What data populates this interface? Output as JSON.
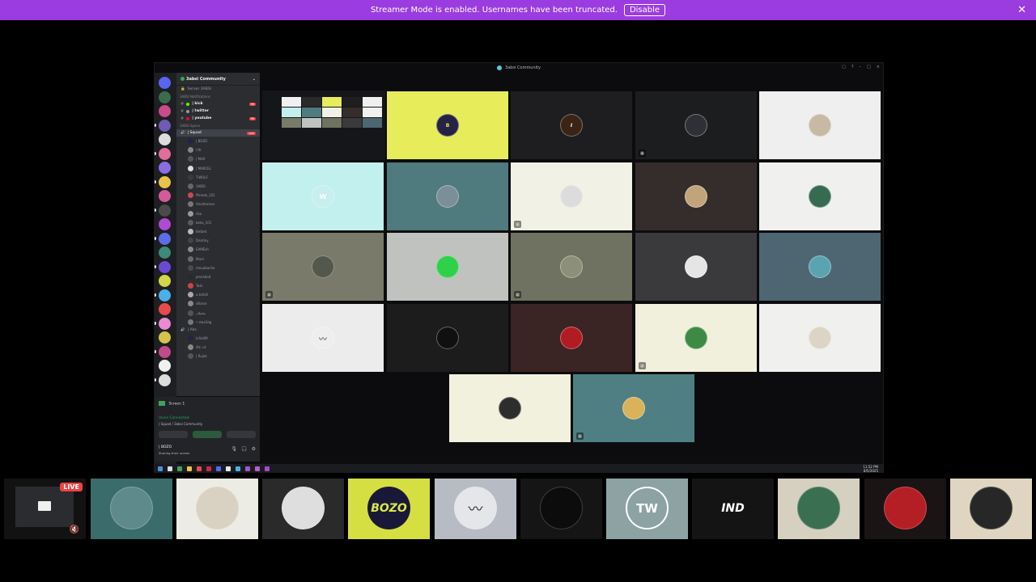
{
  "banner": {
    "message": "Streamer Mode is enabled. Usernames have been truncated.",
    "disable_label": "Disable",
    "close_icon": "close-icon"
  },
  "shared_window": {
    "title": "3absi Community",
    "controls": [
      "▢",
      "?",
      "–",
      "□",
      "×"
    ]
  },
  "discord": {
    "server_name": "3absi Community",
    "server_header": "Server 3ABSI",
    "categories": [
      "3ABSI Notifications",
      "3ABSI Space"
    ],
    "text_channels": [
      {
        "name": "| kick",
        "bullet": "#53fc18",
        "badge": "99"
      },
      {
        "name": "| twitter",
        "bullet": "#949ba4",
        "badge": ""
      },
      {
        "name": "| youtube",
        "bullet": "#ff0033",
        "badge": "99"
      }
    ],
    "voice_channel": "| Squad",
    "voice_live": "LIVE",
    "members": [
      "| BOZO",
      "l.ftr",
      "| Mo9",
      "| MARCEL",
      "T.WOLF",
      "3ABSI",
      "ffmodo_101",
      "Alnothemar",
      "Azo",
      "beko_101",
      "Betbet",
      "Dentiny",
      "EAMEsh",
      "Marri",
      "mouabache",
      "pressbod",
      "Tesk",
      "a.tofalli",
      "silbsse",
      "سلطان",
      "• ewa3ag"
    ],
    "second_voice": "| Abs",
    "second_members": [
      "Lrllo0M",
      "4lz..ut",
      "| Rujok"
    ],
    "panel": {
      "stream_title": "Screen 1",
      "voice_status": "Voice Connected",
      "voice_location": "| Squad / 3absi Community",
      "user": "| BOZO",
      "user_status": "Sharing their screen"
    },
    "clock": {
      "time": "11:52 PM",
      "date": "8/5/2025"
    }
  },
  "grid": {
    "tiles": [
      {
        "bg": "#e6ec5a",
        "avatar": "#262246",
        "kind": "bozo",
        "flag": false
      },
      {
        "bg": "#1e1e20",
        "avatar": "#3a2416",
        "kind": "ind",
        "flag": false
      },
      {
        "bg": "#1c1d1f",
        "avatar": "#2e3036",
        "kind": "photo",
        "flag": true
      },
      {
        "bg": "#efefef",
        "avatar": "#c8b9a5",
        "kind": "photo",
        "flag": false
      },
      {
        "bg": "#c1f0ee",
        "avatar": "#c8eeee",
        "kind": "tw",
        "flag": false
      },
      {
        "bg": "#4f7a7e",
        "avatar": "#7a8f97",
        "kind": "photo",
        "flag": false
      },
      {
        "bg": "#f1f1e6",
        "avatar": "#dcdcdc",
        "kind": "photo",
        "flag": true
      },
      {
        "bg": "#352d2b",
        "avatar": "#c2a47a",
        "kind": "photo",
        "flag": false
      },
      {
        "bg": "#f0f0ef",
        "avatar": "#376b51",
        "kind": "photo",
        "flag": false
      },
      {
        "bg": "#797a6a",
        "avatar": "#54574b",
        "kind": "photo",
        "flag": true
      },
      {
        "bg": "#c0c2bf",
        "avatar": "#2fd04a",
        "kind": "photo",
        "flag": false
      },
      {
        "bg": "#6f7260",
        "avatar": "#8c8f7a",
        "kind": "photo",
        "flag": true
      },
      {
        "bg": "#3a3a3c",
        "avatar": "#e5e5e5",
        "kind": "photo",
        "flag": false
      },
      {
        "bg": "#4e6672",
        "avatar": "#59a4b0",
        "kind": "photo",
        "flag": false
      },
      {
        "bg": "#ececec",
        "avatar": "#eeeeee",
        "kind": "mustache",
        "flag": false
      },
      {
        "bg": "#1c1c1c",
        "avatar": "#101010",
        "kind": "photo",
        "flag": false
      },
      {
        "bg": "#3a2424",
        "avatar": "#b01c22",
        "kind": "photo",
        "flag": false
      },
      {
        "bg": "#f0f0dc",
        "avatar": "#3c8a44",
        "kind": "photo",
        "flag": true
      },
      {
        "bg": "#f0f0ee",
        "avatar": "#dcd4c4",
        "kind": "photo",
        "flag": false
      },
      {
        "bg": "#f1f1dd",
        "avatar": "#2d2d2d",
        "kind": "photo",
        "flag": false
      },
      {
        "bg": "#4f7f83",
        "avatar": "#d9b25a",
        "kind": "photo",
        "flag": true
      }
    ]
  },
  "strip": {
    "live_label": "LIVE",
    "participants": [
      {
        "bg": "#121212",
        "kind": "stream"
      },
      {
        "bg": "#3b6c6c",
        "kind": "photo",
        "avatar": "#5f8a8c"
      },
      {
        "bg": "#ecece4",
        "kind": "photo",
        "avatar": "#d9d1c2"
      },
      {
        "bg": "#2a2a2a",
        "kind": "photo",
        "avatar": "#dedede"
      },
      {
        "bg": "#d6df41",
        "kind": "bozo",
        "label": "BOZO"
      },
      {
        "bg": "#b7bcc4",
        "kind": "mustache"
      },
      {
        "bg": "#151515",
        "kind": "photo",
        "avatar": "#0c0c0c"
      },
      {
        "bg": "#8da3a3",
        "kind": "tw",
        "label": "TW"
      },
      {
        "bg": "#141414",
        "kind": "ind",
        "label": "IND"
      },
      {
        "bg": "#d6d0c0",
        "kind": "photo",
        "avatar": "#3b6f52"
      },
      {
        "bg": "#1b1414",
        "kind": "photo",
        "avatar": "#b41f25"
      },
      {
        "bg": "#e0d5c0",
        "kind": "photo",
        "avatar": "#272727"
      }
    ]
  }
}
